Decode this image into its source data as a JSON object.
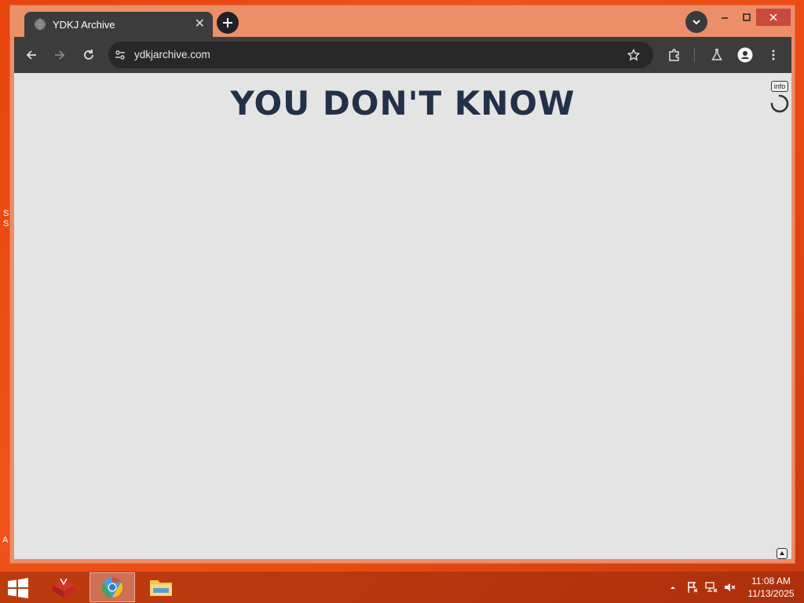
{
  "browser": {
    "tab": {
      "title": "YDKJ Archive"
    },
    "url": "ydkjarchive.com"
  },
  "page": {
    "headline": "YOU DON'T KNOW",
    "info_label": "info"
  },
  "desktop": {
    "edge_text_1": "S\nS",
    "edge_text_2": "A"
  },
  "taskbar": {
    "apps": [
      "winzip-app",
      "chrome-app",
      "file-explorer-app"
    ],
    "clock": {
      "time": "11:08 AM",
      "date": "11/13/2025"
    }
  },
  "colors": {
    "desktop": "#e8430e",
    "window_frame": "#ec8e68",
    "browser_chrome": "#3c3c3c",
    "page_background": "#e4e4e4",
    "headline": "#223147"
  }
}
